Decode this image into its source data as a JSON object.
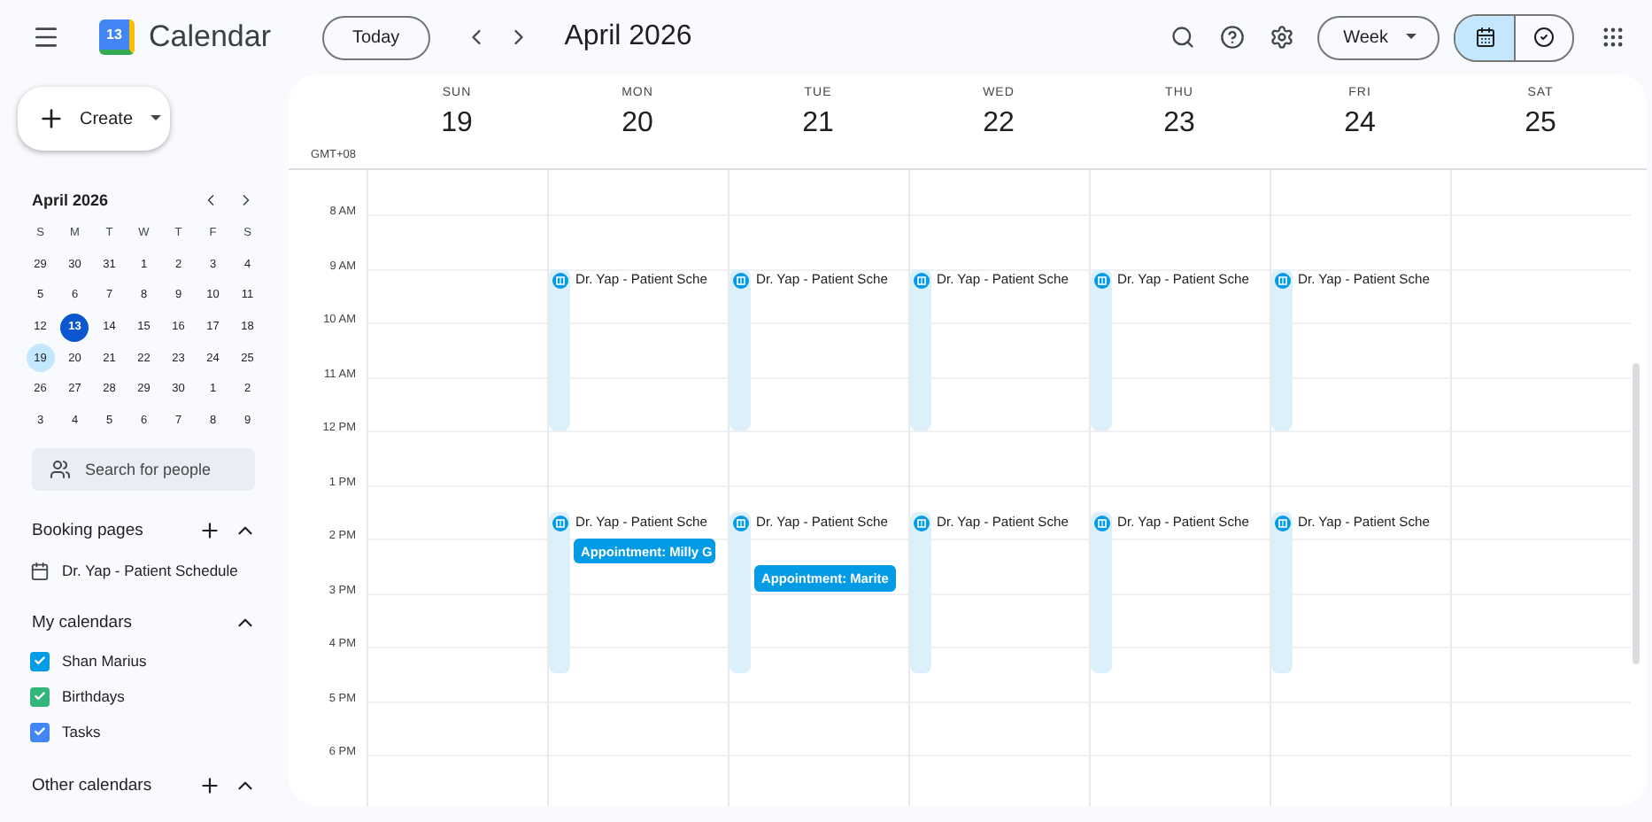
{
  "header": {
    "logo_day": "13",
    "app_name": "Calendar",
    "today_button": "Today",
    "period": "April 2026",
    "view_button": "Week",
    "view_toggle": [
      {
        "kind": "calendar",
        "selected": true
      },
      {
        "kind": "tasks",
        "selected": false
      }
    ]
  },
  "sidebar": {
    "create_button": "Create",
    "mini_calendar": {
      "title": "April 2026",
      "weekdays": [
        "S",
        "M",
        "T",
        "W",
        "T",
        "F",
        "S"
      ],
      "weeks": [
        [
          {
            "d": "29",
            "today": false,
            "selected": false
          },
          {
            "d": "30",
            "today": false,
            "selected": false
          },
          {
            "d": "31",
            "today": false,
            "selected": false
          },
          {
            "d": "1",
            "today": false,
            "selected": false
          },
          {
            "d": "2",
            "today": false,
            "selected": false
          },
          {
            "d": "3",
            "today": false,
            "selected": false
          },
          {
            "d": "4",
            "today": false,
            "selected": false
          }
        ],
        [
          {
            "d": "5",
            "today": false,
            "selected": false
          },
          {
            "d": "6",
            "today": false,
            "selected": false
          },
          {
            "d": "7",
            "today": false,
            "selected": false
          },
          {
            "d": "8",
            "today": false,
            "selected": false
          },
          {
            "d": "9",
            "today": false,
            "selected": false
          },
          {
            "d": "10",
            "today": false,
            "selected": false
          },
          {
            "d": "11",
            "today": false,
            "selected": false
          }
        ],
        [
          {
            "d": "12",
            "today": false,
            "selected": false
          },
          {
            "d": "13",
            "today": true,
            "selected": false
          },
          {
            "d": "14",
            "today": false,
            "selected": false
          },
          {
            "d": "15",
            "today": false,
            "selected": false
          },
          {
            "d": "16",
            "today": false,
            "selected": false
          },
          {
            "d": "17",
            "today": false,
            "selected": false
          },
          {
            "d": "18",
            "today": false,
            "selected": false
          }
        ],
        [
          {
            "d": "19",
            "today": false,
            "selected": true
          },
          {
            "d": "20",
            "today": false,
            "selected": false
          },
          {
            "d": "21",
            "today": false,
            "selected": false
          },
          {
            "d": "22",
            "today": false,
            "selected": false
          },
          {
            "d": "23",
            "today": false,
            "selected": false
          },
          {
            "d": "24",
            "today": false,
            "selected": false
          },
          {
            "d": "25",
            "today": false,
            "selected": false
          }
        ],
        [
          {
            "d": "26",
            "today": false,
            "selected": false
          },
          {
            "d": "27",
            "today": false,
            "selected": false
          },
          {
            "d": "28",
            "today": false,
            "selected": false
          },
          {
            "d": "29",
            "today": false,
            "selected": false
          },
          {
            "d": "30",
            "today": false,
            "selected": false
          },
          {
            "d": "1",
            "today": false,
            "selected": false
          },
          {
            "d": "2",
            "today": false,
            "selected": false
          }
        ],
        [
          {
            "d": "3",
            "today": false,
            "selected": false
          },
          {
            "d": "4",
            "today": false,
            "selected": false
          },
          {
            "d": "5",
            "today": false,
            "selected": false
          },
          {
            "d": "6",
            "today": false,
            "selected": false
          },
          {
            "d": "7",
            "today": false,
            "selected": false
          },
          {
            "d": "8",
            "today": false,
            "selected": false
          },
          {
            "d": "9",
            "today": false,
            "selected": false
          }
        ]
      ]
    },
    "search": {
      "placeholder": "Search for people"
    },
    "booking_pages": {
      "title": "Booking pages",
      "items": [
        "Dr. Yap - Patient Schedule"
      ]
    },
    "my_calendars": {
      "title": "My calendars",
      "items": [
        {
          "name": "Shan Marius",
          "checked": true,
          "color": "#039be5"
        },
        {
          "name": "Birthdays",
          "checked": true,
          "color": "#33b679"
        },
        {
          "name": "Tasks",
          "checked": true,
          "color": "#4285f4"
        }
      ]
    },
    "other_calendars": {
      "title": "Other calendars"
    }
  },
  "week": {
    "timezone": "GMT+08",
    "time_labels": [
      "8 AM",
      "9 AM",
      "10 AM",
      "11 AM",
      "12 PM",
      "1 PM",
      "2 PM",
      "3 PM",
      "4 PM",
      "5 PM",
      "6 PM"
    ],
    "days": [
      {
        "name": "SUN",
        "date": "19"
      },
      {
        "name": "MON",
        "date": "20",
        "events": [
          {
            "kind": "booking",
            "title": "Dr. Yap - Patient Sche",
            "afternoon": false
          },
          {
            "kind": "booking",
            "title": "Dr. Yap - Patient Sche",
            "afternoon": true
          },
          {
            "kind": "appointment",
            "title": "Appointment: Milly G",
            "half_past": false
          }
        ]
      },
      {
        "name": "TUE",
        "date": "21",
        "events": [
          {
            "kind": "booking",
            "title": "Dr. Yap - Patient Sche",
            "afternoon": false
          },
          {
            "kind": "booking",
            "title": "Dr. Yap - Patient Sche",
            "afternoon": true
          },
          {
            "kind": "appointment",
            "title": "Appointment: Marite",
            "half_past": true
          }
        ]
      },
      {
        "name": "WED",
        "date": "22",
        "events": [
          {
            "kind": "booking",
            "title": "Dr. Yap - Patient Sche",
            "afternoon": false
          },
          {
            "kind": "booking",
            "title": "Dr. Yap - Patient Sche",
            "afternoon": true
          }
        ]
      },
      {
        "name": "THU",
        "date": "23",
        "events": [
          {
            "kind": "booking",
            "title": "Dr. Yap - Patient Sche",
            "afternoon": false
          },
          {
            "kind": "booking",
            "title": "Dr. Yap - Patient Sche",
            "afternoon": true
          }
        ]
      },
      {
        "name": "FRI",
        "date": "24",
        "events": [
          {
            "kind": "booking",
            "title": "Dr. Yap - Patient Sche",
            "afternoon": false
          },
          {
            "kind": "booking",
            "title": "Dr. Yap - Patient Sche",
            "afternoon": true
          }
        ]
      },
      {
        "name": "SAT",
        "date": "25"
      }
    ]
  }
}
